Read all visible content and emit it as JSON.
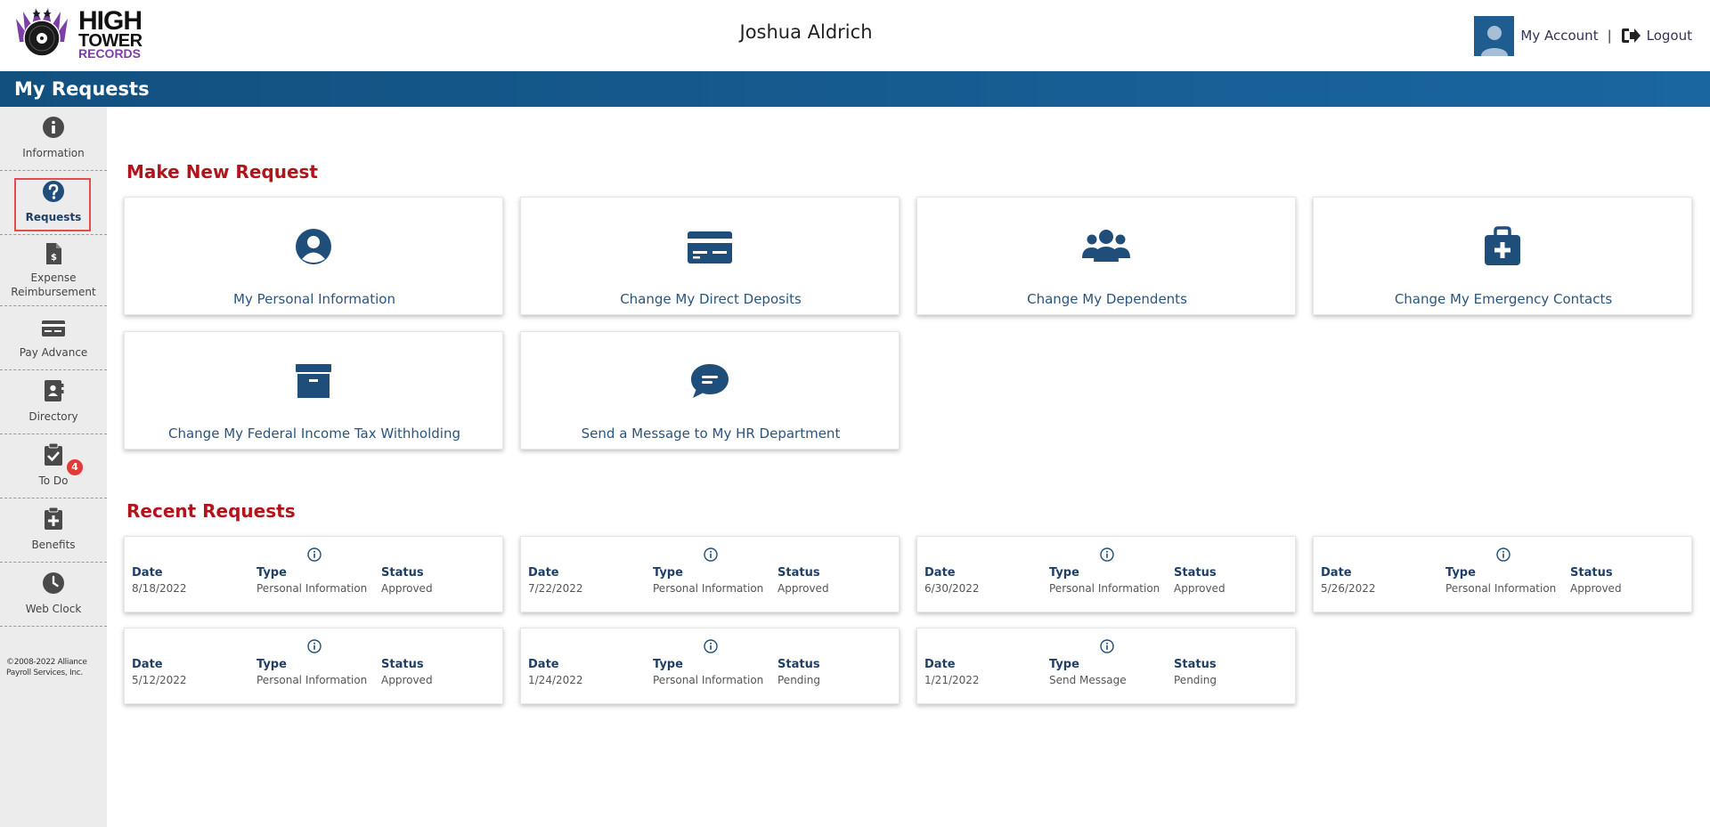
{
  "header": {
    "logo": {
      "line1": "HIGH",
      "line2": "TOWER",
      "line3": "RECORDS"
    },
    "user_name": "Joshua Aldrich",
    "my_account": "My Account",
    "separator": "|",
    "logout": "Logout"
  },
  "page": {
    "title": "My Requests"
  },
  "sidebar": {
    "items": [
      {
        "label": "Information",
        "icon": "info-icon"
      },
      {
        "label": "Requests",
        "icon": "question-icon",
        "active": true
      },
      {
        "label": "Expense Reimbursement",
        "icon": "expense-document-icon"
      },
      {
        "label": "Pay Advance",
        "icon": "money-card-icon"
      },
      {
        "label": "Directory",
        "icon": "address-book-icon"
      },
      {
        "label": "To Do",
        "icon": "clipboard-check-icon",
        "badge": "4"
      },
      {
        "label": "Benefits",
        "icon": "clipboard-plus-icon"
      },
      {
        "label": "Web Clock",
        "icon": "clock-icon"
      }
    ],
    "copyright": "©2008-2022 Alliance Payroll Services, Inc."
  },
  "make_new_request": {
    "title": "Make New Request",
    "cards": [
      {
        "label": "My Personal Information",
        "icon": "user-circle-icon"
      },
      {
        "label": "Change My Direct Deposits",
        "icon": "bank-card-icon"
      },
      {
        "label": "Change My Dependents",
        "icon": "users-group-icon"
      },
      {
        "label": "Change My Emergency Contacts",
        "icon": "medical-kit-icon"
      },
      {
        "label": "Change My Federal Income Tax Withholding",
        "icon": "archive-box-icon"
      },
      {
        "label": "Send a Message to My HR Department",
        "icon": "chat-bubble-icon"
      }
    ]
  },
  "recent_requests": {
    "title": "Recent Requests",
    "headers": {
      "date": "Date",
      "type": "Type",
      "status": "Status"
    },
    "items": [
      {
        "date": "8/18/2022",
        "type": "Personal Information",
        "status": "Approved"
      },
      {
        "date": "7/22/2022",
        "type": "Personal Information",
        "status": "Approved"
      },
      {
        "date": "6/30/2022",
        "type": "Personal Information",
        "status": "Approved"
      },
      {
        "date": "5/26/2022",
        "type": "Personal Information",
        "status": "Approved"
      },
      {
        "date": "5/12/2022",
        "type": "Personal Information",
        "status": "Approved"
      },
      {
        "date": "1/24/2022",
        "type": "Personal Information",
        "status": "Pending"
      },
      {
        "date": "1/21/2022",
        "type": "Send Message",
        "status": "Pending"
      }
    ]
  },
  "colors": {
    "primary": "#1f5c8f",
    "accent_red": "#b3141b",
    "badge_red": "#e53935",
    "sidebar_bg": "#ececec"
  }
}
